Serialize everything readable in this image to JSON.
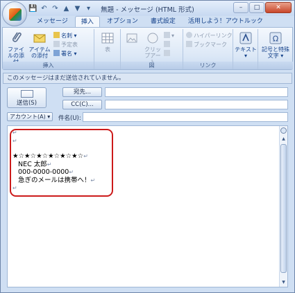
{
  "window": {
    "title": "無題 - メッセージ (HTML 形式)",
    "controls": {
      "minimize": "–",
      "maximize": "□",
      "close": "✕"
    }
  },
  "quick_access": {
    "save": "💾",
    "undo": "↶",
    "redo": "↷",
    "up": "▲",
    "down": "▼",
    "more": "▾"
  },
  "tabs": [
    {
      "label": "メッセージ",
      "active": false
    },
    {
      "label": "挿入",
      "active": true
    },
    {
      "label": "オプション",
      "active": false
    },
    {
      "label": "書式設定",
      "active": false
    },
    {
      "label": "活用しよう！アウトルック",
      "active": false
    }
  ],
  "ribbon": {
    "insert_group": {
      "label": "挿入",
      "attach_file": "ファイルの添付",
      "attach_item": "アイテムの添付",
      "business_card": "名刺",
      "calendar": "予定表",
      "signature": "署名"
    },
    "table_group": {
      "label": "",
      "table": "表"
    },
    "illustration_group": {
      "label": "図",
      "picture": "",
      "clipart": "クリップアート"
    },
    "link_group": {
      "label": "リンク",
      "hyperlink": "ハイパーリンク",
      "bookmark": "ブックマーク"
    },
    "text_group": {
      "label": "",
      "text": "テキスト"
    },
    "symbol_group": {
      "label": "",
      "symbol": "記号と特殊文字"
    }
  },
  "header": {
    "info": "このメッセージはまだ送信されていません。",
    "send": "送信(S)",
    "to": "宛先...",
    "cc": "CC(C)...",
    "account": "アカウント(A)",
    "subject_label": "件名(U):",
    "to_value": "",
    "cc_value": "",
    "subject_value": ""
  },
  "body": {
    "lines": [
      "",
      "",
      "★☆★☆★☆★☆★☆★☆",
      "NEC 太郎",
      "000-0000-0000",
      "急ぎのメールは携帯へ！",
      ""
    ],
    "return_mark": "↵"
  },
  "colors": {
    "accent": "#15428b",
    "highlight": "#cc1a1a"
  }
}
